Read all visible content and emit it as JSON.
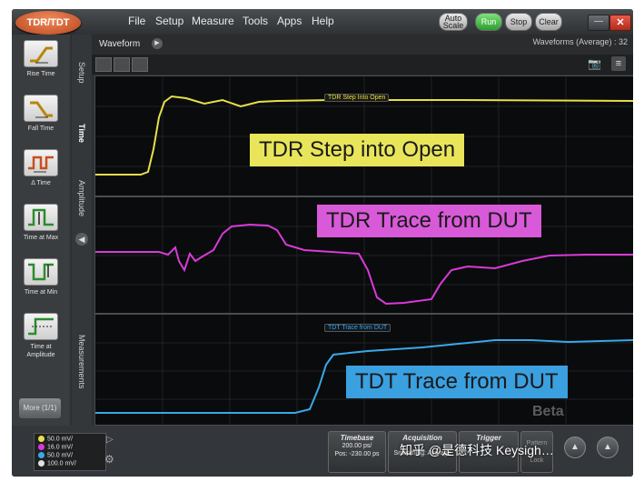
{
  "app": {
    "logo": "TDR/TDT",
    "menu": [
      "File",
      "Setup",
      "Measure",
      "Tools",
      "Apps",
      "Help"
    ],
    "buttons": {
      "autoscale": "Auto Scale",
      "run": "Run",
      "stop": "Stop",
      "clear": "Clear"
    },
    "close_glyph": "✕",
    "minimize_glyph": "—"
  },
  "tools": [
    {
      "label": "Rise Time",
      "icon": "rise-time-icon"
    },
    {
      "label": "Fall Time",
      "icon": "fall-time-icon"
    },
    {
      "label": "Δ Time",
      "icon": "delta-time-icon"
    },
    {
      "label": "Time at Max",
      "icon": "time-at-max-icon"
    },
    {
      "label": "Time at Min",
      "icon": "time-at-min-icon"
    },
    {
      "label": "Time at Amplitude",
      "icon": "time-at-amplitude-icon"
    }
  ],
  "more_label": "More (1/1)",
  "vtabs": [
    "Setup",
    "Time",
    "Amplitude",
    "Measurements"
  ],
  "waveform": {
    "tab": "Waveform",
    "count": "Waveforms (Average) : 32",
    "toolbar": [
      "",
      "",
      ""
    ]
  },
  "plots": [
    {
      "title": "TDR Step Into Open",
      "callout": "TDR Step into Open",
      "color": "#e6e04a",
      "callout_bg": "#e8e55a"
    },
    {
      "title": "",
      "callout": "TDR Trace from DUT",
      "color": "#d83ad8",
      "callout_bg": "#d85ad8"
    },
    {
      "title": "TDT Trace from DUT",
      "callout": "TDT Trace from DUT",
      "color": "#3aa8e8",
      "callout_bg": "#3aa0e0"
    }
  ],
  "scales": [
    {
      "value": "50.0 mV/",
      "color": "#e6e04a"
    },
    {
      "value": "16.0 mV/",
      "color": "#d83ad8"
    },
    {
      "value": "50.0 mV/",
      "color": "#3aa8e8"
    },
    {
      "value": "100.0 mV/",
      "color": "#e0e0e0"
    }
  ],
  "timebase": {
    "title": "Timebase",
    "line1": "200.00 ps/",
    "line2": "Pos: -230.00 ps"
  },
  "acquisition": {
    "title": "Acquisition",
    "line1": "",
    "line2": "Smoothing: Average"
  },
  "trigger": {
    "title": "Trigger",
    "line1": "",
    "line2": ""
  },
  "pattern": {
    "line1": "Pattern",
    "line2": "Lock"
  },
  "watermark": "知乎 @是德科技 Keysigh…",
  "beta": "Beta"
}
